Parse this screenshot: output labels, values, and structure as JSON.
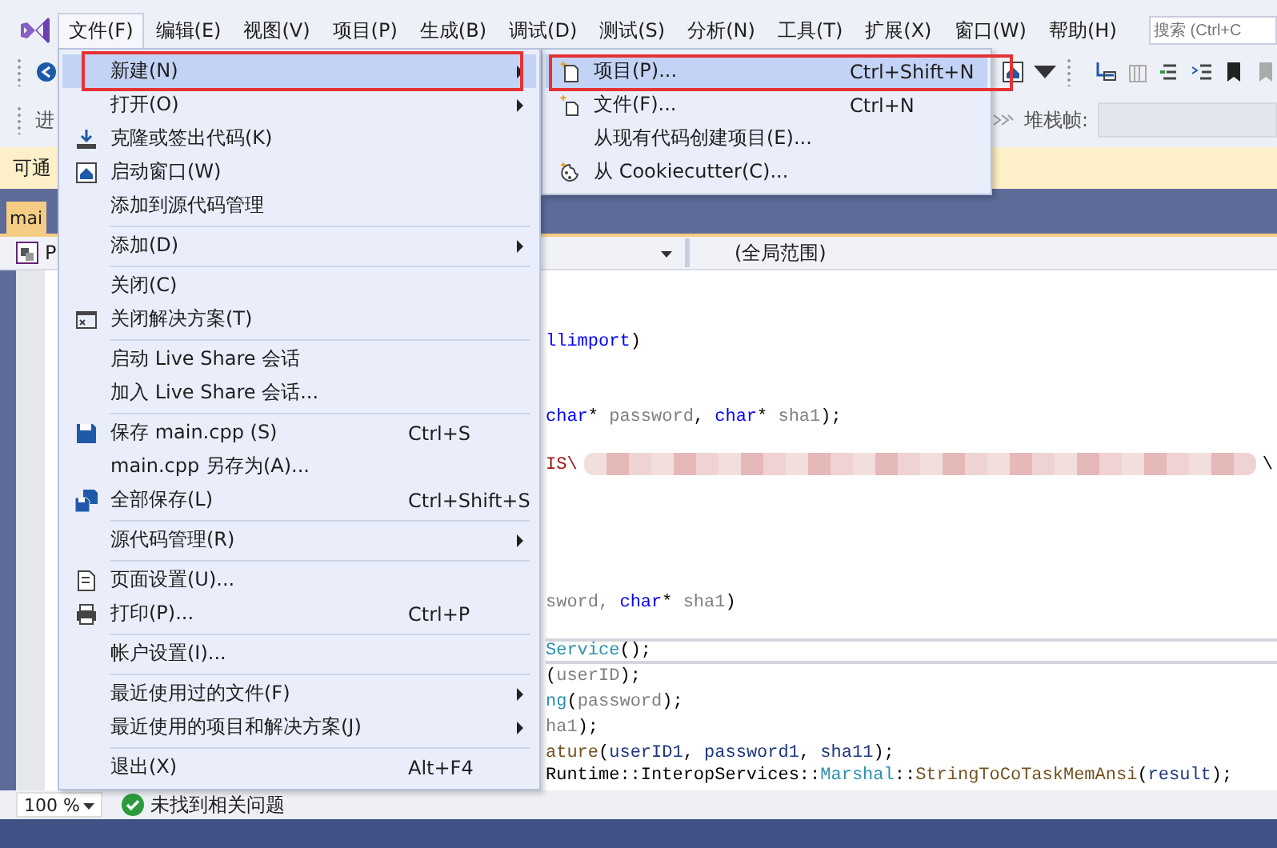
{
  "menubar": {
    "items": [
      {
        "label": "文件(F)",
        "selected": true
      },
      {
        "label": "编辑(E)",
        "selected": false
      },
      {
        "label": "视图(V)",
        "selected": false
      },
      {
        "label": "项目(P)",
        "selected": false
      },
      {
        "label": "生成(B)",
        "selected": false
      },
      {
        "label": "调试(D)",
        "selected": false
      },
      {
        "label": "测试(S)",
        "selected": false
      },
      {
        "label": "分析(N)",
        "selected": false
      },
      {
        "label": "工具(T)",
        "selected": false
      },
      {
        "label": "扩展(X)",
        "selected": false
      },
      {
        "label": "窗口(W)",
        "selected": false
      },
      {
        "label": "帮助(H)",
        "selected": false
      }
    ]
  },
  "search": {
    "placeholder": "搜索 (Ctrl+C"
  },
  "toolbar": {
    "left_label": "进",
    "stack_frame_label": "堆栈帧:"
  },
  "info_bar": {
    "text": "可通"
  },
  "editor_tab": {
    "label": "mai",
    "selected": true
  },
  "nav_bar": {
    "project": "P",
    "scope": "(全局范围)"
  },
  "code_lines": [
    {
      "current": false,
      "segments": [
        {
          "kind": "keyword",
          "text": "llimport"
        },
        {
          "kind": "plain",
          "text": ")"
        }
      ]
    },
    {
      "current": false,
      "segments": [
        {
          "kind": "keyword",
          "text": "char"
        },
        {
          "kind": "plain",
          "text": "* "
        },
        {
          "kind": "param",
          "text": "password"
        },
        {
          "kind": "plain",
          "text": ", "
        },
        {
          "kind": "keyword",
          "text": "char"
        },
        {
          "kind": "plain",
          "text": "* "
        },
        {
          "kind": "param",
          "text": "sha1"
        },
        {
          "kind": "plain",
          "text": ");"
        }
      ]
    },
    {
      "current": false,
      "segments": [
        {
          "kind": "string",
          "text": "IS\\"
        },
        {
          "kind": "redacted"
        },
        {
          "kind": "plain",
          "text": "\\"
        }
      ]
    },
    {
      "current": false,
      "segments": [
        {
          "kind": "param",
          "text": "sword,  "
        },
        {
          "kind": "keyword",
          "text": "char"
        },
        {
          "kind": "plain",
          "text": "* "
        },
        {
          "kind": "param",
          "text": "sha1"
        },
        {
          "kind": "plain",
          "text": ")"
        }
      ]
    },
    {
      "current": true,
      "segments": [
        {
          "kind": "type",
          "text": "Service"
        },
        {
          "kind": "plain",
          "text": "();"
        }
      ]
    },
    {
      "current": false,
      "segments": [
        {
          "kind": "plain",
          "text": "("
        },
        {
          "kind": "param",
          "text": "userID"
        },
        {
          "kind": "plain",
          "text": ");"
        }
      ]
    },
    {
      "current": false,
      "segments": [
        {
          "kind": "type",
          "text": "ng"
        },
        {
          "kind": "plain",
          "text": "("
        },
        {
          "kind": "param",
          "text": "password"
        },
        {
          "kind": "plain",
          "text": ");"
        }
      ]
    },
    {
      "current": false,
      "segments": [
        {
          "kind": "param",
          "text": "ha1"
        },
        {
          "kind": "plain",
          "text": ");"
        }
      ]
    },
    {
      "current": false,
      "segments": [
        {
          "kind": "func",
          "text": "ature"
        },
        {
          "kind": "plain",
          "text": "("
        },
        {
          "kind": "local",
          "text": "userID1"
        },
        {
          "kind": "plain",
          "text": ", "
        },
        {
          "kind": "local",
          "text": "password1"
        },
        {
          "kind": "plain",
          "text": ", "
        },
        {
          "kind": "local",
          "text": "sha11"
        },
        {
          "kind": "plain",
          "text": ");"
        }
      ]
    },
    {
      "current": false,
      "segments": [
        {
          "kind": "plain",
          "text": "Runtime::InteropServices::"
        },
        {
          "kind": "type",
          "text": "Marshal"
        },
        {
          "kind": "plain",
          "text": "::"
        },
        {
          "kind": "func",
          "text": "StringToCoTaskMemAnsi"
        },
        {
          "kind": "plain",
          "text": "("
        },
        {
          "kind": "local",
          "text": "result"
        },
        {
          "kind": "plain",
          "text": ");"
        }
      ]
    }
  ],
  "status_bar": {
    "zoom": "100 %",
    "issues": "未找到相关问题"
  },
  "file_menu": {
    "items": [
      {
        "kind": "item",
        "label": "新建(N)",
        "submenu": true,
        "selected": true,
        "marked": true
      },
      {
        "kind": "item",
        "label": "打开(O)",
        "submenu": true,
        "selected": false,
        "marked": false
      },
      {
        "kind": "item",
        "label": "克隆或签出代码(K)",
        "submenu": false,
        "selected": false,
        "marked": false
      },
      {
        "kind": "item",
        "label": "启动窗口(W)",
        "submenu": false,
        "selected": false,
        "marked": false
      },
      {
        "kind": "item",
        "label": "添加到源代码管理",
        "submenu": false,
        "selected": false,
        "marked": false
      },
      {
        "kind": "separator"
      },
      {
        "kind": "item",
        "label": "添加(D)",
        "submenu": true,
        "selected": false,
        "marked": false
      },
      {
        "kind": "separator"
      },
      {
        "kind": "item",
        "label": "关闭(C)",
        "submenu": false,
        "selected": false,
        "marked": false
      },
      {
        "kind": "item",
        "label": "关闭解决方案(T)",
        "submenu": false,
        "selected": false,
        "marked": false
      },
      {
        "kind": "separator"
      },
      {
        "kind": "item",
        "label": "启动 Live Share 会话",
        "submenu": false,
        "selected": false,
        "marked": false
      },
      {
        "kind": "item",
        "label": "加入 Live Share 会话...",
        "submenu": false,
        "selected": false,
        "marked": false
      },
      {
        "kind": "separator"
      },
      {
        "kind": "item",
        "label": "保存 main.cpp (S)",
        "shortcut": "Ctrl+S",
        "submenu": false,
        "selected": false,
        "marked": false
      },
      {
        "kind": "item",
        "label": "main.cpp 另存为(A)...",
        "submenu": false,
        "selected": false,
        "marked": false
      },
      {
        "kind": "item",
        "label": "全部保存(L)",
        "shortcut": "Ctrl+Shift+S",
        "submenu": false,
        "selected": false,
        "marked": false
      },
      {
        "kind": "separator"
      },
      {
        "kind": "item",
        "label": "源代码管理(R)",
        "submenu": true,
        "selected": false,
        "marked": false
      },
      {
        "kind": "separator"
      },
      {
        "kind": "item",
        "label": "页面设置(U)...",
        "submenu": false,
        "selected": false,
        "marked": false
      },
      {
        "kind": "item",
        "label": "打印(P)...",
        "shortcut": "Ctrl+P",
        "submenu": false,
        "selected": false,
        "marked": false
      },
      {
        "kind": "separator"
      },
      {
        "kind": "item",
        "label": "帐户设置(I)...",
        "submenu": false,
        "selected": false,
        "marked": false
      },
      {
        "kind": "separator"
      },
      {
        "kind": "item",
        "label": "最近使用过的文件(F)",
        "submenu": true,
        "selected": false,
        "marked": false
      },
      {
        "kind": "item",
        "label": "最近使用的项目和解决方案(J)",
        "submenu": true,
        "selected": false,
        "marked": false
      },
      {
        "kind": "separator"
      },
      {
        "kind": "item",
        "label": "退出(X)",
        "shortcut": "Alt+F4",
        "submenu": false,
        "selected": false,
        "marked": false
      }
    ]
  },
  "new_submenu": {
    "items": [
      {
        "kind": "item",
        "label": "项目(P)...",
        "shortcut": "Ctrl+Shift+N",
        "submenu": false,
        "selected": true,
        "marked": true
      },
      {
        "kind": "item",
        "label": "文件(F)...",
        "shortcut": "Ctrl+N",
        "submenu": false,
        "selected": false,
        "marked": false
      },
      {
        "kind": "item",
        "label": "从现有代码创建项目(E)...",
        "submenu": false,
        "selected": false,
        "marked": false
      },
      {
        "kind": "item",
        "label": "从 Cookiecutter(C)...",
        "submenu": false,
        "selected": false,
        "marked": false
      }
    ]
  }
}
